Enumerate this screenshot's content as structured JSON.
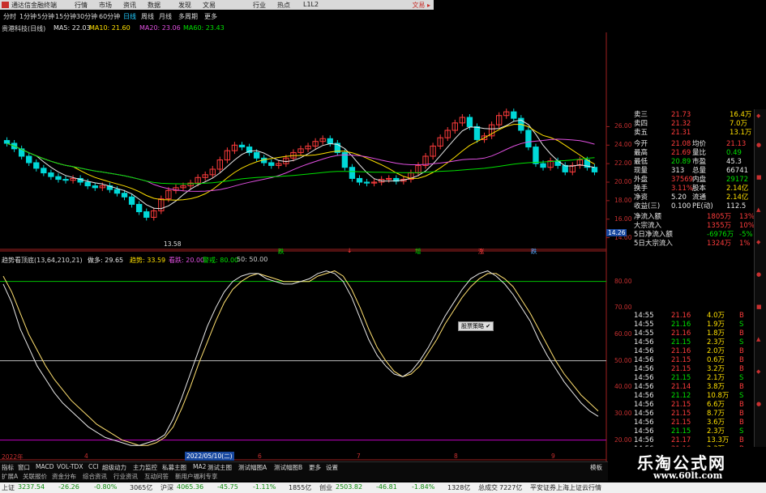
{
  "window": {
    "title": "通达信金融终端",
    "menu": [
      "行情",
      "市场",
      "资讯",
      "数据",
      "发现",
      "文易",
      "行业",
      "热点",
      "L1L2"
    ],
    "brand": "文易 ▸"
  },
  "period_tabs": [
    "分时",
    "1分钟",
    "5分钟",
    "15分钟",
    "30分钟",
    "60分钟",
    "日线",
    "周线",
    "月线",
    "多周期",
    "更多"
  ],
  "selected_period": "日线",
  "stock_label": "贵港科技(日线)",
  "ma_legend": [
    {
      "label": "MA5: 22.03",
      "color": "#e8e8e8"
    },
    {
      "label": "MA10: 21.60",
      "color": "#ffe000"
    },
    {
      "label": "MA20: 23.06",
      "color": "#e050e0"
    },
    {
      "label": "MA60: 23.43",
      "color": "#00e000"
    }
  ],
  "price_axis": [
    "26.00",
    "24.00",
    "22.00",
    "20.00",
    "18.00",
    "16.00",
    "14.00"
  ],
  "low_marker": "13.58",
  "price_marker": "14.26",
  "osc_header": {
    "name": "趋势看顶底(13,64,210,21)",
    "items": [
      {
        "label": "做多: 29.65",
        "color": "#e8e8e8"
      },
      {
        "label": "趋势: 33.59",
        "color": "#ffe000"
      },
      {
        "label": "看跌: 20.00",
        "color": "#e050e0"
      },
      {
        "label": "警戒: 80.00",
        "color": "#00e000"
      },
      {
        "label": "50: 50.00",
        "color": "#ccc"
      }
    ]
  },
  "osc_axis": [
    "80.00",
    "70.00",
    "60.00",
    "50.00",
    "40.00",
    "30.00",
    "20.00"
  ],
  "markers": [
    "跌",
    "↓",
    "增",
    "涨",
    "跌"
  ],
  "tooltip": "股票策略 ✔ ",
  "date_label": "2022/05/10(二)",
  "date_ticks": [
    "2022年",
    "4",
    "5",
    "6",
    "7",
    "8",
    "9"
  ],
  "quote": {
    "asks": [
      {
        "label": "卖三",
        "price": "21.73",
        "vol": "16.4万"
      },
      {
        "label": "卖四",
        "price": "21.32",
        "vol": "7.0万"
      },
      {
        "label": "卖五",
        "price": "21.31",
        "vol": "13.1万"
      }
    ],
    "rows": [
      {
        "k1": "今开",
        "v1": "21.08",
        "k2": "均价",
        "v2": "21.13"
      },
      {
        "k1": "最高",
        "v1": "21.69",
        "k2": "量比",
        "v2": "0.49"
      },
      {
        "k1": "最低",
        "v1": "20.89",
        "k2": "市盈",
        "v2": "45.3"
      },
      {
        "k1": "现量",
        "v1": "313",
        "k2": "总量",
        "v2": "66741"
      },
      {
        "k1": "外盘",
        "v1": "37569",
        "k2": "内盘",
        "v2": "29172"
      },
      {
        "k1": "换手",
        "v1": "3.11%",
        "k2": "股本",
        "v2": "2.14亿"
      },
      {
        "k1": "净资",
        "v1": "5.20",
        "k2": "流通",
        "v2": "2.14亿"
      },
      {
        "k1": "收益(三)",
        "v1": "0.100",
        "k2": "PE(动)",
        "v2": "112.5"
      }
    ],
    "flows": [
      {
        "label": "净流入额",
        "value": "1805万",
        "pct": "13%"
      },
      {
        "label": "大宗流入",
        "value": "1355万",
        "pct": "10%"
      },
      {
        "label": "5日净流入额",
        "value": "-6976万",
        "pct": "-5%"
      },
      {
        "label": "5日大宗流入",
        "value": "1324万",
        "pct": "1%"
      }
    ],
    "ticks": [
      {
        "t": "14:55",
        "p": "21.16",
        "v": "4.0万",
        "d": "B"
      },
      {
        "t": "14:55",
        "p": "21.16",
        "v": "1.9万",
        "d": "S"
      },
      {
        "t": "14:55",
        "p": "21.16",
        "v": "1.8万",
        "d": "B"
      },
      {
        "t": "14:56",
        "p": "21.15",
        "v": "2.3万",
        "d": "S"
      },
      {
        "t": "14:56",
        "p": "21.16",
        "v": "2.0万",
        "d": "B"
      },
      {
        "t": "14:56",
        "p": "21.15",
        "v": "0.6万",
        "d": "B"
      },
      {
        "t": "14:56",
        "p": "21.15",
        "v": "3.2万",
        "d": "B"
      },
      {
        "t": "14:56",
        "p": "21.15",
        "v": "2.1万",
        "d": "S"
      },
      {
        "t": "14:56",
        "p": "21.14",
        "v": "3.8万",
        "d": "B"
      },
      {
        "t": "14:56",
        "p": "21.12",
        "v": "10.8万",
        "d": "S"
      },
      {
        "t": "14:56",
        "p": "21.15",
        "v": "6.6万",
        "d": "B"
      },
      {
        "t": "14:56",
        "p": "21.15",
        "v": "8.7万",
        "d": "B"
      },
      {
        "t": "14:56",
        "p": "21.15",
        "v": "3.6万",
        "d": "B"
      },
      {
        "t": "14:56",
        "p": "21.15",
        "v": "2.3万",
        "d": "S"
      },
      {
        "t": "14:56",
        "p": "21.17",
        "v": "13.3万",
        "d": "B"
      },
      {
        "t": "14:56",
        "p": "21.16",
        "v": "2.3万",
        "d": "B"
      },
      {
        "t": "14:56",
        "p": "21.16",
        "v": "2.3万",
        "d": "B"
      }
    ]
  },
  "bottom_tabs": [
    "指标",
    "窗口",
    "MACD",
    "VOL-TDX",
    "CCI",
    "超级动力",
    "主力监控",
    "私募主图",
    "MA2",
    "测试主图",
    "测试幅图A",
    "测试幅图B",
    "更多",
    "设置"
  ],
  "bottom_tabs2": [
    "扩展A",
    "关联报价",
    "资金分布",
    "综合资讯",
    "行业资讯",
    "互动问答",
    "新用户福利专享"
  ],
  "bottom_right": "模板",
  "status": [
    {
      "text": "上证",
      "color": "#222"
    },
    {
      "text": "3237.54",
      "color": "#0a8a0a"
    },
    {
      "text": "-26.26",
      "color": "#0a8a0a"
    },
    {
      "text": "-0.80%",
      "color": "#0a8a0a"
    },
    {
      "text": "3065亿",
      "color": "#222"
    },
    {
      "text": "沪深",
      "color": "#222"
    },
    {
      "text": "4065.36",
      "color": "#0a8a0a"
    },
    {
      "text": "-45.75",
      "color": "#0a8a0a"
    },
    {
      "text": "-1.11%",
      "color": "#0a8a0a"
    },
    {
      "text": "1855亿",
      "color": "#222"
    },
    {
      "text": "创业",
      "color": "#222"
    },
    {
      "text": "2503.82",
      "color": "#0a8a0a"
    },
    {
      "text": "-46.81",
      "color": "#0a8a0a"
    },
    {
      "text": "-1.84%",
      "color": "#0a8a0a"
    },
    {
      "text": "1328亿",
      "color": "#222"
    },
    {
      "text": "总成交",
      "color": "#222"
    },
    {
      "text": "7227亿",
      "color": "#222"
    },
    {
      "text": "平安证券上海上证云行情",
      "color": "#222"
    }
  ],
  "watermark": {
    "line1": "乐淘公式网",
    "line2": "www.60lt.com"
  },
  "chart_data": {
    "type": "line",
    "price_ylim": [
      13,
      27
    ],
    "close": [
      24.2,
      23.6,
      22.8,
      22.1,
      21.5,
      21.0,
      20.6,
      20.3,
      20.2,
      20.4,
      20.0,
      19.6,
      19.4,
      19.6,
      19.2,
      18.8,
      18.4,
      17.6,
      16.8,
      16.2,
      16.9,
      18.2,
      19.1,
      19.4,
      19.6,
      19.9,
      20.5,
      20.8,
      21.4,
      22.4,
      23.4,
      24.0,
      23.8,
      23.2,
      22.6,
      22.1,
      21.8,
      22.0,
      22.6,
      23.2,
      23.6,
      23.9,
      24.4,
      24.7,
      24.2,
      23.2,
      21.6,
      20.4,
      20.0,
      19.9,
      20.0,
      20.3,
      20.4,
      20.1,
      20.3,
      21.0,
      21.8,
      22.8,
      23.9,
      24.8,
      25.6,
      26.4,
      27.0,
      26.0,
      24.6,
      25.0,
      26.2,
      27.2,
      27.6,
      26.9,
      25.6,
      23.8,
      22.0,
      21.6,
      22.3,
      21.8,
      21.1,
      21.8,
      22.4,
      21.6,
      21.1
    ],
    "osc_ylim": [
      15,
      90
    ],
    "osc_fast": [
      79,
      72,
      62,
      55,
      48,
      43,
      38,
      34,
      31,
      28,
      25,
      23,
      21,
      20,
      19,
      18,
      18,
      19,
      20,
      22,
      28,
      36,
      45,
      54,
      63,
      70,
      76,
      80,
      82,
      83,
      83,
      81,
      80,
      79,
      79,
      80,
      81,
      83,
      84,
      83,
      80,
      74,
      66,
      58,
      52,
      48,
      45,
      44,
      46,
      50,
      55,
      61,
      67,
      72,
      77,
      81,
      83,
      84,
      82,
      79,
      75,
      70,
      65,
      58,
      52,
      47,
      42,
      38,
      34,
      31,
      29
    ],
    "osc_slow": [
      82,
      76,
      68,
      60,
      54,
      48,
      43,
      39,
      35,
      32,
      29,
      26,
      24,
      22,
      20,
      19,
      18,
      18,
      19,
      21,
      25,
      32,
      40,
      49,
      57,
      65,
      72,
      77,
      80,
      82,
      83,
      82,
      81,
      80,
      80,
      80,
      80,
      82,
      83,
      84,
      82,
      77,
      70,
      62,
      55,
      50,
      46,
      44,
      45,
      48,
      53,
      58,
      64,
      69,
      74,
      78,
      81,
      83,
      83,
      81,
      78,
      73,
      68,
      62,
      56,
      50,
      45,
      41,
      37,
      34,
      31
    ],
    "levels": [
      80,
      50,
      20
    ]
  }
}
